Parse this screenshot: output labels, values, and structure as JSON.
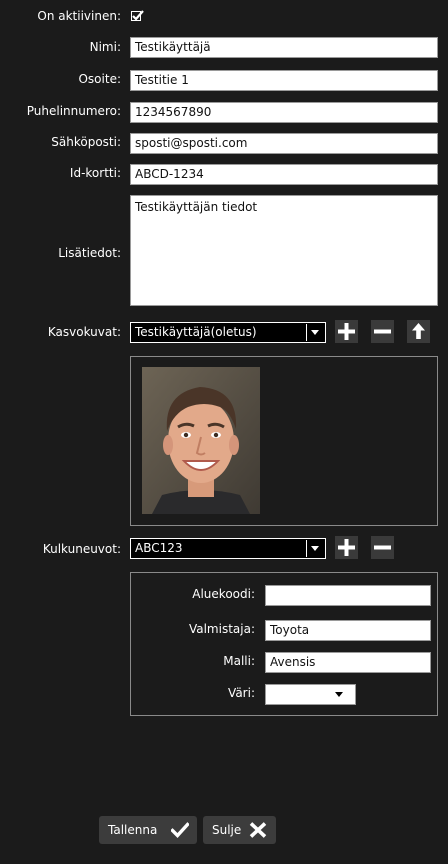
{
  "form": {
    "active_label": "On aktiivinen:",
    "active_checked": true,
    "name_label": "Nimi:",
    "name_value": "Testikäyttäjä",
    "address_label": "Osoite:",
    "address_value": "Testitie 1",
    "phone_label": "Puhelinnumero:",
    "phone_value": "1234567890",
    "email_label": "Sähköposti:",
    "email_value": "sposti@sposti.com",
    "idcard_label": "Id-kortti:",
    "idcard_value": "ABCD-1234",
    "notes_label": "Lisätiedot:",
    "notes_value": "Testikäyttäjän tiedot"
  },
  "faces": {
    "label": "Kasvokuvat:",
    "selected": "Testikäyttäjä(oletus)",
    "add_icon": "plus-icon",
    "remove_icon": "minus-icon",
    "upload_icon": "arrow-up-icon"
  },
  "vehicles": {
    "label": "Kulkuneuvot:",
    "selected": "ABC123",
    "add_icon": "plus-icon",
    "remove_icon": "minus-icon",
    "details": {
      "area_code_label": "Aluekoodi:",
      "area_code_value": "",
      "maker_label": "Valmistaja:",
      "maker_value": "Toyota",
      "model_label": "Malli:",
      "model_value": "Avensis",
      "color_label": "Väri:",
      "color_value": ""
    }
  },
  "buttons": {
    "save_label": "Tallenna",
    "save_icon": "checkmark-icon",
    "close_label": "Sulje",
    "close_icon": "close-icon"
  },
  "colors": {
    "background": "#1b1b1b",
    "button": "#3c3c3c",
    "icon_button": "#3a3a3a"
  }
}
